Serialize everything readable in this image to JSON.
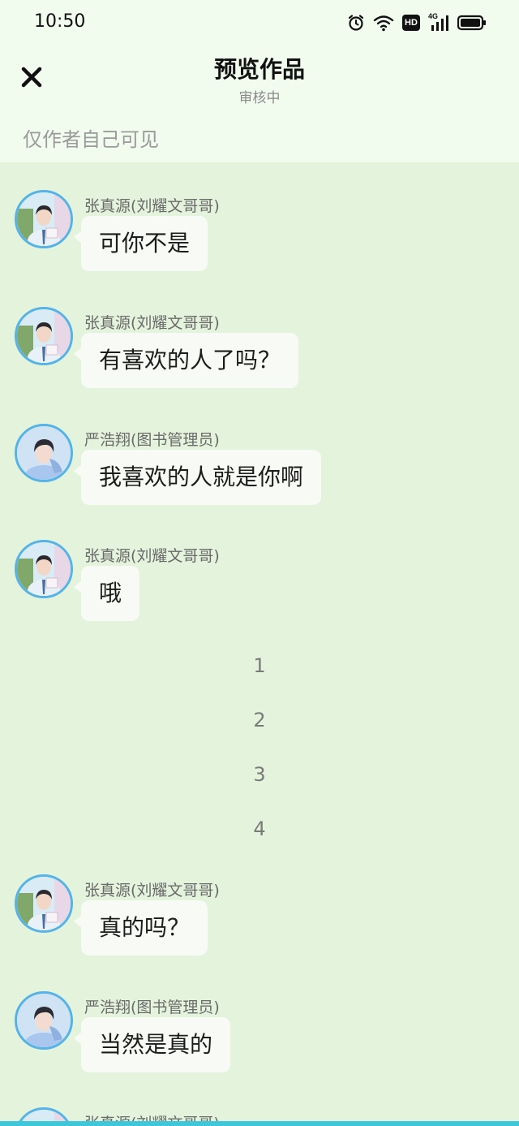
{
  "status_bar": {
    "time": "10:50",
    "hd_label": "HD",
    "network_label": "4G"
  },
  "header": {
    "title": "预览作品",
    "subtitle": "审核中",
    "visibility_note": "仅作者自己可见"
  },
  "colors": {
    "page_bg": "#f1fcef",
    "chat_bg": "#e4f3dc",
    "bubble_bg": "#f8fbf5",
    "avatar_ring": "#56b3e6",
    "bottom_strip": "#3ec7d9"
  },
  "messages": [
    {
      "sender": "张真源(刘耀文哥哥)",
      "text": "可你不是",
      "avatar": "avatar-zhang"
    },
    {
      "sender": "张真源(刘耀文哥哥)",
      "text": "有喜欢的人了吗？",
      "avatar": "avatar-zhang"
    },
    {
      "sender": "严浩翔(图书管理员)",
      "text": "我喜欢的人就是你啊",
      "avatar": "avatar-yan"
    },
    {
      "sender": "张真源(刘耀文哥哥)",
      "text": "哦",
      "avatar": "avatar-zhang"
    },
    {
      "sender": "张真源(刘耀文哥哥)",
      "text": "真的吗？",
      "avatar": "avatar-zhang"
    },
    {
      "sender": "严浩翔(图书管理员)",
      "text": "当然是真的",
      "avatar": "avatar-yan"
    },
    {
      "sender": "张真源(刘耀文哥哥)",
      "text": "",
      "avatar": "avatar-zhang"
    }
  ],
  "dividers": [
    "1",
    "2",
    "3",
    "4"
  ]
}
